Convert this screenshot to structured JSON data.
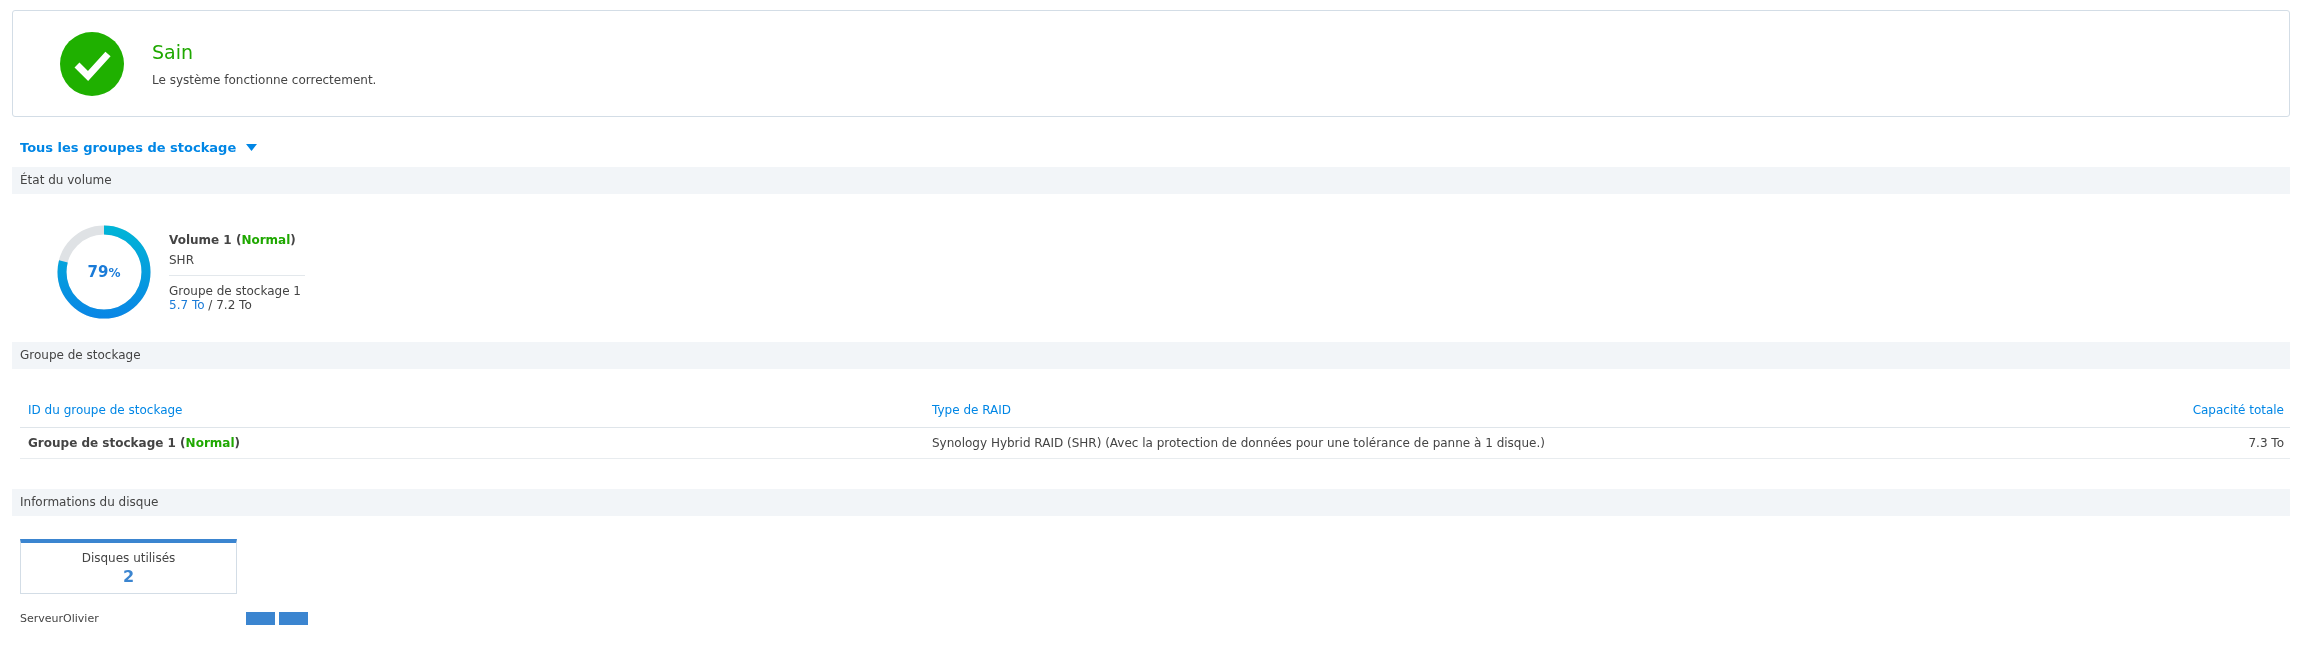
{
  "status": {
    "title": "Sain",
    "message": "Le système fonctionne correctement.",
    "healthy": true
  },
  "pool_selector": {
    "label": "Tous les groupes de stockage"
  },
  "volume_section": {
    "title": "État du volume",
    "volume": {
      "level": 0.79,
      "percent": "79",
      "percent_unit": "%",
      "name": "Volume 1 (",
      "status": "Normal",
      "name_end": ")",
      "type": "SHR",
      "pool": "Groupe de stockage 1",
      "used": "5.7 To",
      "separator": " / ",
      "total": "7.2 To"
    }
  },
  "pool_section": {
    "title": "Groupe de stockage",
    "table": {
      "columns": [
        "ID du groupe de stockage",
        "Type de RAID",
        "Capacité totale"
      ],
      "rows": [
        {
          "id_name": "Groupe de stockage 1 (",
          "status": "Normal",
          "id_end": ")",
          "raid": "Synology Hybrid RAID (SHR) (Avec la protection de données pour une tolérance de panne à 1 disque.)",
          "capacity": "7.3 To"
        }
      ]
    }
  },
  "disk_section": {
    "title": "Informations du disque",
    "summary": {
      "label": "Disques utilisés",
      "count": "2"
    },
    "server": {
      "name": "ServeurOlivier",
      "disks": [
        {
          "kind": "disk"
        },
        {
          "kind": "disk"
        }
      ]
    }
  }
}
